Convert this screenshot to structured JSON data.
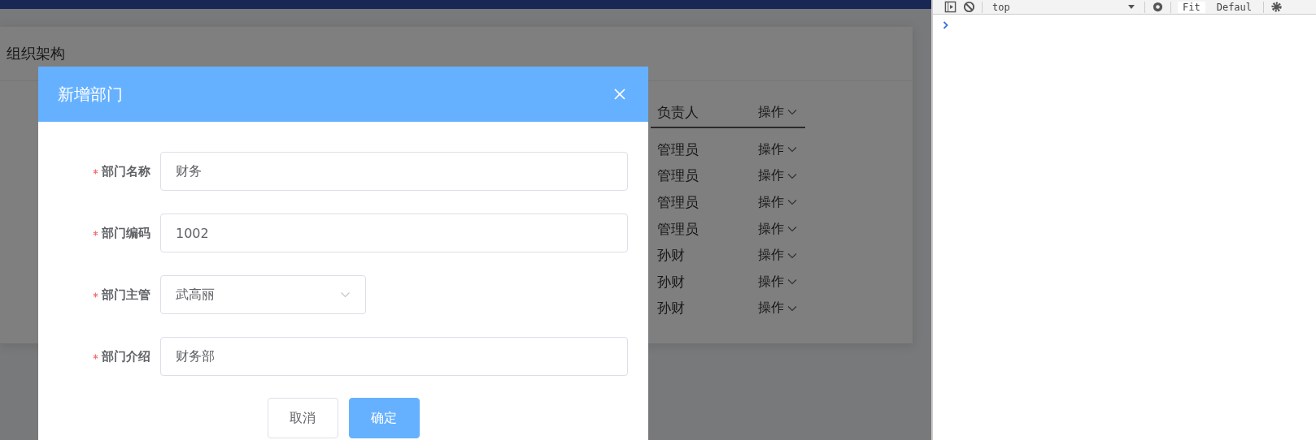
{
  "page": {
    "title": "组织架构",
    "table": {
      "columns": [
        "负责人",
        "操作"
      ],
      "rows": [
        {
          "manager": "管理员",
          "action": "操作"
        },
        {
          "manager": "管理员",
          "action": "操作"
        },
        {
          "manager": "管理员",
          "action": "操作"
        },
        {
          "manager": "管理员",
          "action": "操作"
        },
        {
          "manager": "孙财",
          "action": "操作"
        },
        {
          "manager": "孙财",
          "action": "操作"
        },
        {
          "manager": "孙财",
          "action": "操作"
        }
      ]
    }
  },
  "dialog": {
    "title": "新增部门",
    "fields": [
      {
        "label": "部门名称",
        "required": true,
        "kind": "input",
        "value": "财务"
      },
      {
        "label": "部门编码",
        "required": true,
        "kind": "input",
        "value": "1002"
      },
      {
        "label": "部门主管",
        "required": true,
        "kind": "select",
        "value": "武高丽"
      },
      {
        "label": "部门介绍",
        "required": true,
        "kind": "input",
        "value": "财务部"
      }
    ],
    "buttons": [
      {
        "label": "取消",
        "kind": "default"
      },
      {
        "label": "确定",
        "kind": "primary"
      }
    ]
  },
  "devtools": {
    "context": "top",
    "zoom_labels": [
      "Fit",
      "Defaul"
    ]
  }
}
